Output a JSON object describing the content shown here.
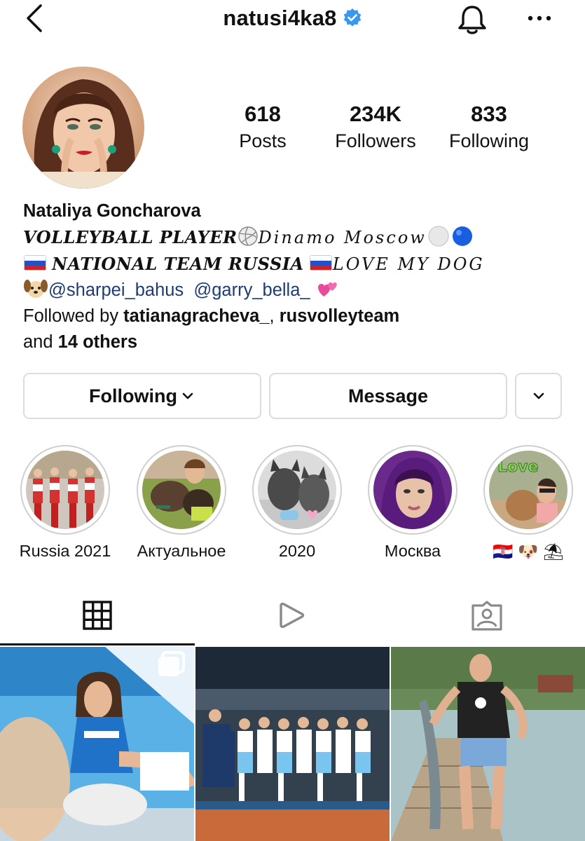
{
  "header": {
    "username": "natusi4ka8"
  },
  "stats": [
    {
      "count": "618",
      "label": "Posts"
    },
    {
      "count": "234K",
      "label": "Followers"
    },
    {
      "count": "833",
      "label": "Following"
    }
  ],
  "bio": {
    "full_name": "Nataliya Goncharova",
    "line1_bold": "VOLLEYBALL PLAYER",
    "line1_script": "Dinamo Moscow",
    "line2_bold": "NATIONAL TEAM RUSSIA",
    "line2_script": "LOVE MY DOG",
    "mention1": "@sharpei_bahus",
    "mention2": "@garry_bella_",
    "followed_by_prefix": "Followed by ",
    "followed_by_users": "tatianagracheva_",
    "followed_by_sep": ", ",
    "followed_by_user2": "rusvolleyteam",
    "and_prefix": "and ",
    "others": "14 others"
  },
  "actions": {
    "following_label": "Following",
    "message_label": "Message"
  },
  "highlights": [
    {
      "caption": "Russia 2021"
    },
    {
      "caption": "Актуальное"
    },
    {
      "caption": "2020"
    },
    {
      "caption": "Москва"
    },
    {
      "caption": "🇭🇷 🐶 ⛱"
    }
  ],
  "tabs": [
    {
      "icon": "grid-icon"
    },
    {
      "icon": "reels-play-icon"
    },
    {
      "icon": "tagged-person-icon"
    }
  ],
  "colors": {
    "verified": "#3897f0",
    "mention": "#1f3c70",
    "border": "#dcdcdc"
  }
}
